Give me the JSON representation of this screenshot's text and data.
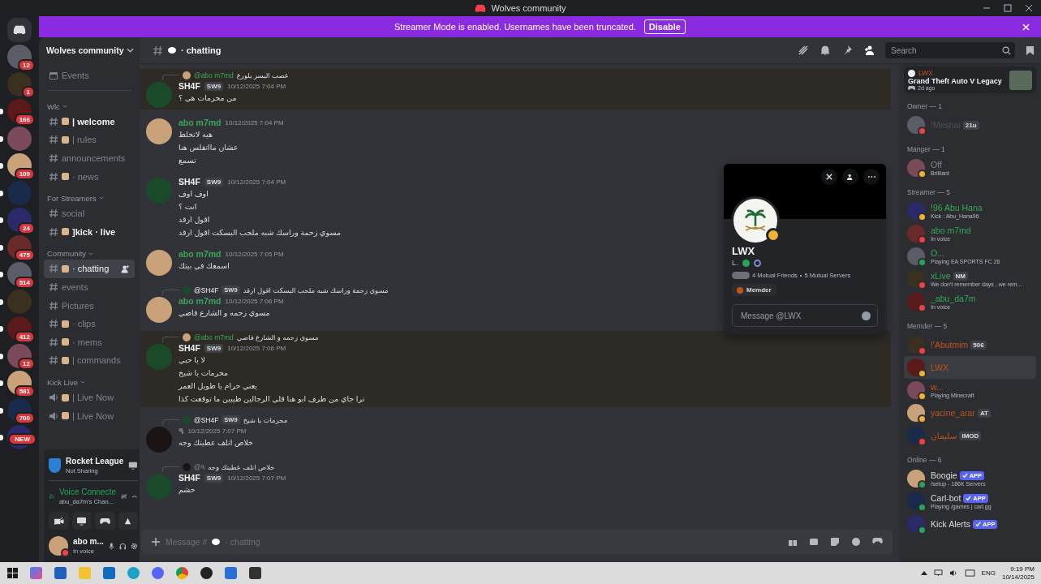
{
  "window": {
    "title": "Wolves community"
  },
  "banner": {
    "text": "Streamer Mode is enabled. Usernames have been truncated.",
    "button": "Disable"
  },
  "servers": [
    {
      "badge": "12",
      "unread": false
    },
    {
      "badge": "1",
      "unread": false
    },
    {
      "badge": "166",
      "unread": true
    },
    {
      "unread": true
    },
    {
      "badge": "109",
      "unread": true
    },
    {
      "unread": true
    },
    {
      "badge": "24",
      "unread": true
    },
    {
      "badge": "475",
      "unread": true
    },
    {
      "badge": "514",
      "unread": true
    },
    {
      "unread": true
    },
    {
      "badge": "412",
      "unread": true
    },
    {
      "badge": "12",
      "unread": true
    },
    {
      "badge": "581",
      "unread": true
    },
    {
      "badge": "700",
      "unread": true
    },
    {
      "badge": "NEW",
      "unread": true
    }
  ],
  "sidebar": {
    "server_name": "Wolves community",
    "events": "Events",
    "categories": [
      {
        "name": "Wlc",
        "channels": [
          {
            "name": "| welcome",
            "kind": "text",
            "emoji": true,
            "unread": true,
            "selected": false
          },
          {
            "name": "| rules",
            "kind": "text",
            "emoji": true,
            "unread": false,
            "selected": false
          },
          {
            "name": "announcements",
            "kind": "text",
            "emoji": false,
            "unread": false,
            "selected": false
          },
          {
            "name": "· news",
            "kind": "text",
            "emoji": true,
            "unread": false,
            "selected": false
          }
        ]
      },
      {
        "name": "For Streamers",
        "channels": [
          {
            "name": "social",
            "kind": "text",
            "emoji": false,
            "unread": false,
            "selected": false
          },
          {
            "name": "]kick · live",
            "kind": "text",
            "emoji": true,
            "unread": true,
            "selected": false
          }
        ]
      },
      {
        "name": "Community",
        "channels": [
          {
            "name": "· chatting",
            "kind": "text",
            "emoji": true,
            "unread": false,
            "selected": true
          },
          {
            "name": "events",
            "kind": "text",
            "emoji": false,
            "unread": false,
            "selected": false
          },
          {
            "name": "Pictures",
            "kind": "text",
            "emoji": false,
            "unread": false,
            "selected": false
          },
          {
            "name": "· clips",
            "kind": "text",
            "emoji": true,
            "unread": false,
            "selected": false
          },
          {
            "name": "· mems",
            "kind": "text",
            "emoji": true,
            "unread": false,
            "selected": false
          },
          {
            "name": "| commands",
            "kind": "text",
            "emoji": true,
            "unread": false,
            "selected": false
          }
        ]
      },
      {
        "name": "Kick Live",
        "channels": [
          {
            "name": "| Live Now",
            "kind": "voice",
            "emoji": true,
            "unread": false,
            "selected": false
          },
          {
            "name": "| Live Now",
            "kind": "voice",
            "emoji": true,
            "unread": false,
            "selected": false
          }
        ]
      }
    ]
  },
  "activity_panel": {
    "title": "Rocket League",
    "subtitle": "Not Sharing"
  },
  "voice_panel": {
    "status": "Voice Connecte",
    "channel": "abu_da7m's Chan..."
  },
  "user_panel": {
    "name": "abo m...",
    "status": "In voice"
  },
  "header": {
    "channel": "· chatting",
    "placeholder": "Search"
  },
  "messages": [
    {
      "reply": {
        "name": "@abo m7md",
        "kind": "streamer",
        "text": "عصب اليسر يلورع"
      },
      "author": "SH4F",
      "kind": "default",
      "tag": "SW9",
      "time": "10/12/2025 7:04 PM",
      "highlighted": true,
      "lines": [
        "من محرمات هي ؟"
      ]
    },
    {
      "author": "abo m7md",
      "kind": "streamer",
      "time": "10/12/2025 7:04 PM",
      "highlighted": false,
      "lines": [
        "هيه لاتخلط",
        "عشان مااتقلس هنا",
        "تسمع"
      ]
    },
    {
      "author": "SH4F",
      "kind": "default",
      "tag": "SW9",
      "time": "10/12/2025 7:04 PM",
      "highlighted": false,
      "lines": [
        "اوف اوف",
        "انت ؟",
        "اقول ارقد",
        "مسوي زحمة وراسك شبه ملحب البسكت اقول ارقد"
      ]
    },
    {
      "author": "abo m7md",
      "kind": "streamer",
      "time": "10/12/2025 7:05 PM",
      "highlighted": false,
      "lines": [
        "اسمعك في بيتك"
      ]
    },
    {
      "reply": {
        "name": "@SH4F",
        "kind": "default",
        "tag": "SW9",
        "text": "مسوي زحمة وراسك شبه ملحب البسكت اقول ارقد"
      },
      "author": "abo m7md",
      "kind": "streamer",
      "time": "10/12/2025 7:06 PM",
      "highlighted": false,
      "lines": [
        "مسوي زحمه و الشارع فاضي"
      ]
    },
    {
      "reply": {
        "name": "@abo m7md",
        "kind": "streamer",
        "text": "مسوي زحمه و الشارع فاضي"
      },
      "author": "SH4F",
      "kind": "default",
      "tag": "SW9",
      "time": "10/12/2025 7:06 PM",
      "highlighted": true,
      "lines": [
        "لا يا حبي",
        "محرمات يا شيخ",
        "يعني حرام يا طويل العمر",
        "ترا جاي من طرف ابو هنا قلي الرجالين طيبين ما توقعت كذا"
      ]
    },
    {
      "reply": {
        "name": "@SH4F",
        "kind": "default",
        "tag": "SW9",
        "text": "محرمات يا شيخ"
      },
      "author": "٩",
      "kind": "faint",
      "time": "10/12/2025 7:07 PM",
      "highlighted": false,
      "lines": [
        "خلاص اتلف عطيتك وجه"
      ]
    },
    {
      "reply": {
        "name": "@٩",
        "kind": "faint",
        "text": "خلاص اتلف عطيتك وجه"
      },
      "author": "SH4F",
      "kind": "default",
      "tag": "SW9",
      "time": "10/12/2025 7:07 PM",
      "highlighted": false,
      "lines": [
        "حشم"
      ]
    }
  ],
  "composer": {
    "placeholder_start": "Message #",
    "placeholder_end": "· chatting"
  },
  "profile_popup": {
    "name": "LWX",
    "subtitle": "L.",
    "mutual_friends": "4 Mutual Friends",
    "separator": "•",
    "mutual_servers": "5 Mutual Servers",
    "role": {
      "name": "Memder",
      "color": "#c2531a"
    },
    "message_placeholder": "Message @LWX",
    "color": "#f0b232"
  },
  "members": {
    "activity": {
      "user": "LWX",
      "game": "Grand Theft Auto V Legacy",
      "time": "2d ago"
    },
    "sections": [
      {
        "title": "Owner — 1",
        "members": [
          {
            "name": "!Meshal",
            "kind": "owner",
            "color": "#f23f43",
            "badge": {
              "text": "21u",
              "kind": "tag"
            },
            "selected": false
          }
        ]
      },
      {
        "title": "Manger — 1",
        "members": [
          {
            "name": "Off",
            "kind": "manager",
            "color": "#f0b232",
            "sub": "Brilliant",
            "selected": false
          }
        ]
      },
      {
        "title": "Streamer — 5",
        "members": [
          {
            "name": "!96 Abu Hana",
            "kind": "streamer",
            "color": "#f0b232",
            "sub": "Kick : Abu_Hana96",
            "selected": false
          },
          {
            "name": "abo m7md",
            "kind": "streamer",
            "color": "#f23f43",
            "sub": "In voice",
            "selected": false
          },
          {
            "name": "O...",
            "kind": "streamer",
            "color": "#23a55a",
            "sub": "Playing EA SPORTS FC 26",
            "selected": false
          },
          {
            "name": "xLive",
            "kind": "streamer",
            "color": "#f23f43",
            "badge": {
              "text": "NM",
              "kind": "tag"
            },
            "sub": "We don't remember days , we rem...",
            "selected": false
          },
          {
            "name": "_abu_da7m",
            "kind": "streamer",
            "color": "#f23f43",
            "sub": "In voice",
            "selected": false
          }
        ]
      },
      {
        "title": "Memder — 5",
        "members": [
          {
            "name": "!'Abutmim",
            "kind": "member",
            "color": "#f23f43",
            "badge": {
              "text": "506",
              "kind": "tag"
            },
            "selected": false
          },
          {
            "name": "LWX",
            "kind": "member",
            "color": "#f0b232",
            "selected": true
          },
          {
            "name": "w...",
            "kind": "member",
            "color": "#f0b232",
            "sub": "Playing Minecraft",
            "selected": false
          },
          {
            "name": "yacine_arar",
            "kind": "member",
            "color": "#f0b232",
            "badge": {
              "text": "AT",
              "kind": "tag"
            },
            "selected": false
          },
          {
            "name": "سليمان",
            "kind": "member",
            "color": "#f23f43",
            "badge": {
              "text": "IMOD",
              "kind": "tag"
            },
            "selected": false
          }
        ]
      },
      {
        "title": "Online — 6",
        "members": [
          {
            "name": "Boogie",
            "kind": "bot",
            "color": "#23a55a",
            "badge": {
              "text": "APP",
              "kind": "app"
            },
            "sub": "/setup - 186K Servers",
            "selected": false
          },
          {
            "name": "Carl-bot",
            "kind": "bot",
            "color": "#23a55a",
            "badge": {
              "text": "APP",
              "kind": "app"
            },
            "sub": "Playing /games | carl.gg",
            "selected": false
          },
          {
            "name": "Kick Alerts",
            "kind": "bot",
            "color": "#23a55a",
            "badge": {
              "text": "APP",
              "kind": "app"
            },
            "selected": false
          }
        ]
      }
    ]
  },
  "taskbar": {
    "language": "ENG",
    "time": "9:19 PM",
    "date": "10/14/2025"
  }
}
